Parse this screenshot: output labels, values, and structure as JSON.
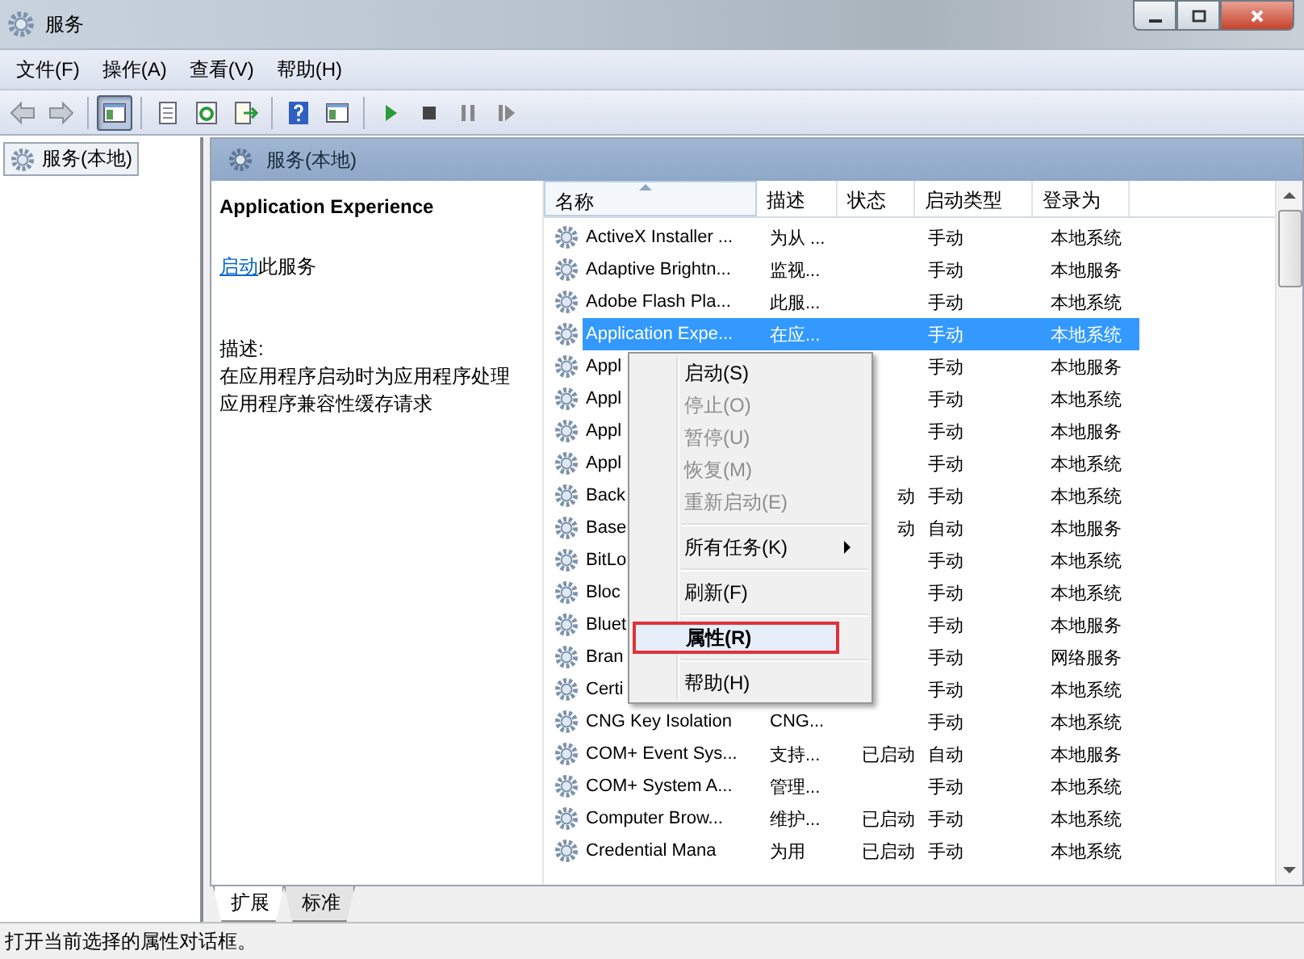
{
  "window": {
    "title": "服务"
  },
  "menu": [
    "文件(F)",
    "操作(A)",
    "查看(V)",
    "帮助(H)"
  ],
  "toolbar": [
    {
      "kind": "back",
      "pressed": false
    },
    {
      "kind": "forward",
      "pressed": false
    },
    {
      "kind": "sep"
    },
    {
      "kind": "tree",
      "pressed": true
    },
    {
      "kind": "sep"
    },
    {
      "kind": "props",
      "pressed": false
    },
    {
      "kind": "refresh",
      "pressed": false
    },
    {
      "kind": "export",
      "pressed": false
    },
    {
      "kind": "sep"
    },
    {
      "kind": "help",
      "pressed": false
    },
    {
      "kind": "pane",
      "pressed": false
    },
    {
      "kind": "sep"
    },
    {
      "kind": "play",
      "pressed": false
    },
    {
      "kind": "stop",
      "pressed": false
    },
    {
      "kind": "pause",
      "pressed": false
    },
    {
      "kind": "resume",
      "pressed": false
    }
  ],
  "tree": {
    "items": [
      {
        "label": "服务(本地)",
        "selected": true
      }
    ]
  },
  "pane_title": "服务(本地)",
  "details": {
    "title": "Application Experience",
    "action_link": "启动",
    "action_rest": "此服务",
    "description_label": "描述:",
    "description": "在应用程序启动时为应用程序处理应用程序兼容性缓存请求"
  },
  "table": {
    "columns": [
      "名称",
      "描述",
      "状态",
      "启动类型",
      "登录为"
    ],
    "rows": [
      {
        "cells": [
          "ActiveX Installer ...",
          "为从 ...",
          "",
          "手动",
          "本地系统"
        ],
        "selected": false
      },
      {
        "cells": [
          "Adaptive Brightn...",
          "监视...",
          "",
          "手动",
          "本地服务"
        ],
        "selected": false
      },
      {
        "cells": [
          "Adobe Flash Pla...",
          "此服...",
          "",
          "手动",
          "本地系统"
        ],
        "selected": false
      },
      {
        "cells": [
          "Application Expe...",
          "在应...",
          "",
          "手动",
          "本地系统"
        ],
        "selected": true
      },
      {
        "cells": [
          "Appl",
          "",
          "",
          "手动",
          "本地服务"
        ],
        "selected": false
      },
      {
        "cells": [
          "Appl",
          "",
          "",
          "手动",
          "本地系统"
        ],
        "selected": false
      },
      {
        "cells": [
          "Appl",
          "",
          "",
          "手动",
          "本地服务"
        ],
        "selected": false
      },
      {
        "cells": [
          "Appl",
          "",
          "",
          "手动",
          "本地系统"
        ],
        "selected": false
      },
      {
        "cells": [
          "Back",
          "",
          "动",
          "手动",
          "本地系统"
        ],
        "selected": false
      },
      {
        "cells": [
          "Base",
          "",
          "动",
          "自动",
          "本地服务"
        ],
        "selected": false
      },
      {
        "cells": [
          "BitLo",
          "",
          "",
          "手动",
          "本地系统"
        ],
        "selected": false
      },
      {
        "cells": [
          "Bloc",
          "",
          "",
          "手动",
          "本地系统"
        ],
        "selected": false
      },
      {
        "cells": [
          "Bluet",
          "",
          "",
          "手动",
          "本地服务"
        ],
        "selected": false
      },
      {
        "cells": [
          "Bran",
          "",
          "",
          "手动",
          "网络服务"
        ],
        "selected": false
      },
      {
        "cells": [
          "Certi",
          "",
          "",
          "手动",
          "本地系统"
        ],
        "selected": false
      },
      {
        "cells": [
          "CNG Key Isolation",
          "CNG...",
          "",
          "手动",
          "本地系统"
        ],
        "selected": false
      },
      {
        "cells": [
          "COM+ Event Sys...",
          "支持...",
          "已启动",
          "自动",
          "本地服务"
        ],
        "selected": false
      },
      {
        "cells": [
          "COM+ System A...",
          "管理...",
          "",
          "手动",
          "本地系统"
        ],
        "selected": false
      },
      {
        "cells": [
          "Computer Brow...",
          "维护...",
          "已启动",
          "手动",
          "本地系统"
        ],
        "selected": false
      },
      {
        "cells": [
          "Credential Mana",
          "为用",
          "已启动",
          "手动",
          "本地系统"
        ],
        "selected": false
      }
    ]
  },
  "context_menu": [
    {
      "kind": "item",
      "label": "启动(S)",
      "disabled": false,
      "selected": false
    },
    {
      "kind": "item",
      "label": "停止(O)",
      "disabled": true,
      "selected": false
    },
    {
      "kind": "item",
      "label": "暂停(U)",
      "disabled": true,
      "selected": false
    },
    {
      "kind": "item",
      "label": "恢复(M)",
      "disabled": true,
      "selected": false
    },
    {
      "kind": "item",
      "label": "重新启动(E)",
      "disabled": true,
      "selected": false
    },
    {
      "kind": "sep"
    },
    {
      "kind": "submenu",
      "label": "所有任务(K)",
      "disabled": false,
      "selected": false
    },
    {
      "kind": "sep"
    },
    {
      "kind": "item",
      "label": "刷新(F)",
      "disabled": false,
      "selected": false
    },
    {
      "kind": "sep"
    },
    {
      "kind": "item",
      "label": "属性(R)",
      "disabled": false,
      "selected": true
    },
    {
      "kind": "sep"
    },
    {
      "kind": "item",
      "label": "帮助(H)",
      "disabled": false,
      "selected": false
    }
  ],
  "bottom_tabs": [
    {
      "label": "扩展",
      "selected": true
    },
    {
      "label": "标准",
      "selected": false
    }
  ],
  "status_bar": "打开当前选择的属性对话框。"
}
